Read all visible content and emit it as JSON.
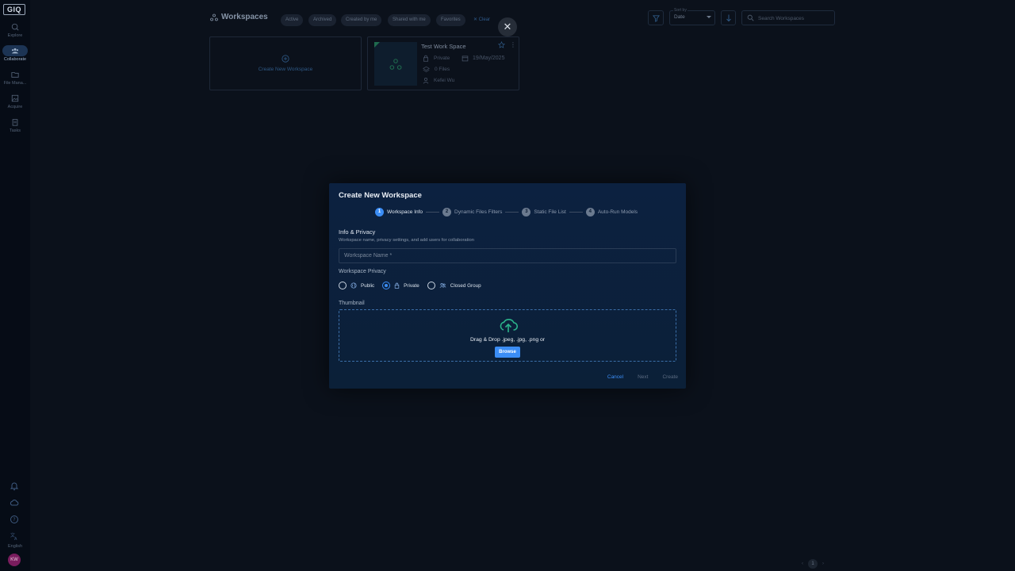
{
  "sidebar": {
    "logo": "GIQ",
    "items": [
      {
        "label": "Explore",
        "icon": "globe-search-icon",
        "active": false
      },
      {
        "label": "Collaborate",
        "icon": "people-icon",
        "active": true
      },
      {
        "label": "File Mana...",
        "icon": "folder-icon",
        "active": false
      },
      {
        "label": "Acquire",
        "icon": "image-icon",
        "active": false
      },
      {
        "label": "Tasks",
        "icon": "clipboard-icon",
        "active": false
      }
    ],
    "language": "English",
    "avatar_initials": "KW"
  },
  "header": {
    "title": "Workspaces",
    "filters": [
      "Active",
      "Archived",
      "Created by me",
      "Shared with me",
      "Favorites"
    ],
    "clear_label": "Clear",
    "sort_label": "Sort by",
    "sort_value": "Date",
    "search_placeholder": "Search Workspaces"
  },
  "cards": {
    "new_label": "Create New Workspace",
    "workspace": {
      "name": "Test Work Space",
      "privacy": "Private",
      "date": "19/May/2025",
      "files": "0 Files",
      "owner": "Kefei Wu"
    }
  },
  "pagination": {
    "current": "1"
  },
  "modal": {
    "title": "Create New Workspace",
    "steps": [
      {
        "num": "1",
        "label": "Workspace Info",
        "active": true
      },
      {
        "num": "2",
        "label": "Dynamic Files Filters",
        "active": false
      },
      {
        "num": "3",
        "label": "Static File List",
        "active": false
      },
      {
        "num": "4",
        "label": "Auto-Run Models",
        "active": false
      }
    ],
    "section_title": "Info & Privacy",
    "section_desc": "Workspace name, privacy settings, and add users for collaboration",
    "name_placeholder": "Workspace Name *",
    "name_value": "",
    "privacy_title": "Workspace Privacy",
    "privacy_options": [
      {
        "label": "Public",
        "selected": false
      },
      {
        "label": "Private",
        "selected": true
      },
      {
        "label": "Closed Group",
        "selected": false
      }
    ],
    "thumbnail_title": "Thumbnail",
    "drop_text": "Drag & Drop .jpeg, .jpg, .png or",
    "browse_label": "Browse",
    "cancel_label": "Cancel",
    "next_label": "Next",
    "create_label": "Create"
  },
  "colors": {
    "accent": "#3b8df5",
    "modal_bg": "#0c2140",
    "page_bg": "#0b111b",
    "upload_icon": "#2bb38a"
  }
}
